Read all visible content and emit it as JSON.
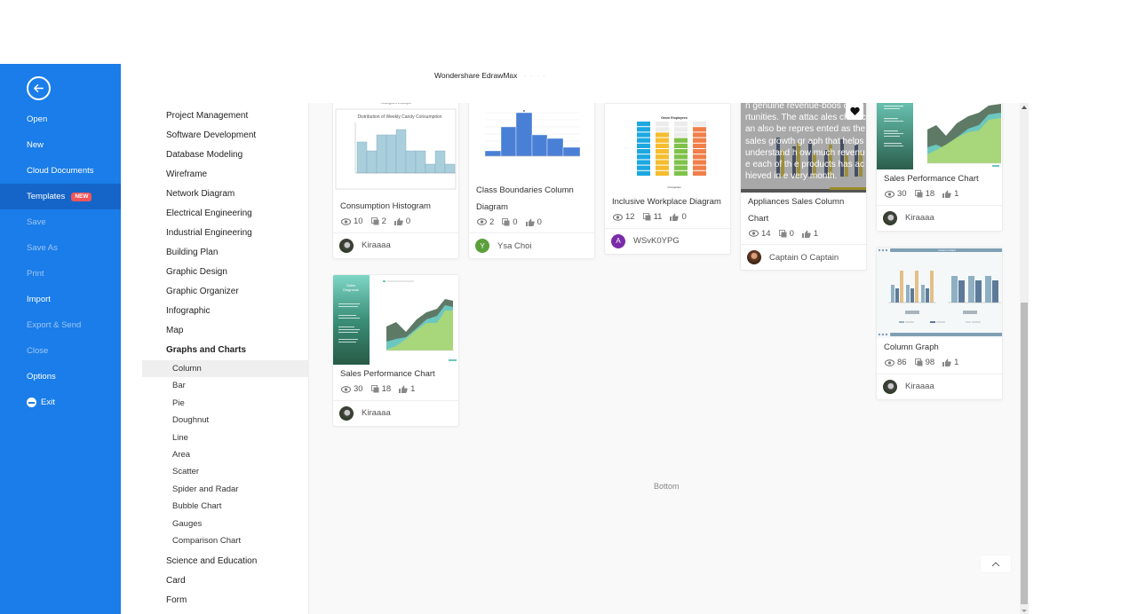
{
  "app": {
    "title": "Wondershare EdrawMax",
    "title_suffix": "- · · ·  · · ·"
  },
  "leftnav": {
    "back_icon": "arrow-left-circle-icon",
    "items": [
      {
        "label": "Open",
        "enabled": true
      },
      {
        "label": "New",
        "enabled": true
      },
      {
        "label": "Cloud Documents",
        "enabled": true
      },
      {
        "label": "Templates",
        "enabled": true,
        "active": true,
        "badge": "NEW"
      },
      {
        "label": "Save",
        "enabled": false
      },
      {
        "label": "Save As",
        "enabled": false
      },
      {
        "label": "Print",
        "enabled": false
      },
      {
        "label": "Import",
        "enabled": true
      },
      {
        "label": "Export & Send",
        "enabled": false
      },
      {
        "label": "Close",
        "enabled": false
      },
      {
        "label": "Options",
        "enabled": true
      },
      {
        "label": "Exit",
        "enabled": true,
        "icon": "minus-circle-icon"
      }
    ]
  },
  "categories": {
    "top": [
      "Project Management",
      "Software Development",
      "Database Modeling",
      "Wireframe",
      "Network Diagram",
      "Electrical Engineering",
      "Industrial Engineering",
      "Building Plan",
      "Graphic Design",
      "Graphic Organizer",
      "Infographic",
      "Map",
      "Graphs and Charts"
    ],
    "selected_parent": "Graphs and Charts",
    "sub": [
      "Column",
      "Bar",
      "Pie",
      "Doughnut",
      "Line",
      "Area",
      "Scatter",
      "Spider and Radar",
      "Bubble Chart",
      "Gauges",
      "Comparison Chart"
    ],
    "selected_sub": "Column",
    "after": [
      "Science and Education",
      "Card",
      "Form"
    ]
  },
  "templates": [
    {
      "title": "Consumption Histogram",
      "views": "10",
      "copies": "2",
      "likes": "0",
      "author": "Kiraaaa",
      "avatar": "photo",
      "thumb_caption": "Histogram Example",
      "thumb_title": "Distribution of Weekly Candy Consumption"
    },
    {
      "title": "Class Boundaries Column Diagram",
      "views": "2",
      "copies": "0",
      "likes": "0",
      "author": "Ysa Choi",
      "avatar_letter": "Y"
    },
    {
      "title": "Inclusive Workplace Diagram",
      "views": "12",
      "copies": "11",
      "likes": "0",
      "author": "WSvK0YPG",
      "avatar_letter": "A",
      "thumb_title": "Green Employees"
    },
    {
      "title": "Appliances Sales Column Chart",
      "views": "14",
      "copies": "0",
      "likes": "1",
      "author": "Captain O Captain",
      "avatar": "photo",
      "thumb_overlay": "n genuine revenue-boos opportunities. The attac ales chart can also be repres ented as the sales growth gr aph that helps understand h ow much revenue each of th e products has achieved in e very month."
    },
    {
      "title": "Sales Performance Chart",
      "views": "30",
      "copies": "18",
      "likes": "1",
      "author": "Kiraaaa",
      "avatar": "photo"
    },
    {
      "title": "Sales Performance Chart",
      "views": "30",
      "copies": "18",
      "likes": "1",
      "author": "Kiraaaa",
      "avatar": "photo",
      "thumb_title": "Sales Diagnosis"
    },
    {
      "title": "Column Graph",
      "views": "86",
      "copies": "98",
      "likes": "1",
      "author": "Kiraaaa",
      "avatar": "photo",
      "thumb_title": "Column Graph"
    }
  ],
  "footer": {
    "bottom_label": "Bottom",
    "back_to_top_icon": "chevron-up-icon"
  },
  "colors": {
    "nav_blue": "#1a7de9",
    "nav_active": "#1565c8",
    "badge_red": "#f2545b"
  }
}
